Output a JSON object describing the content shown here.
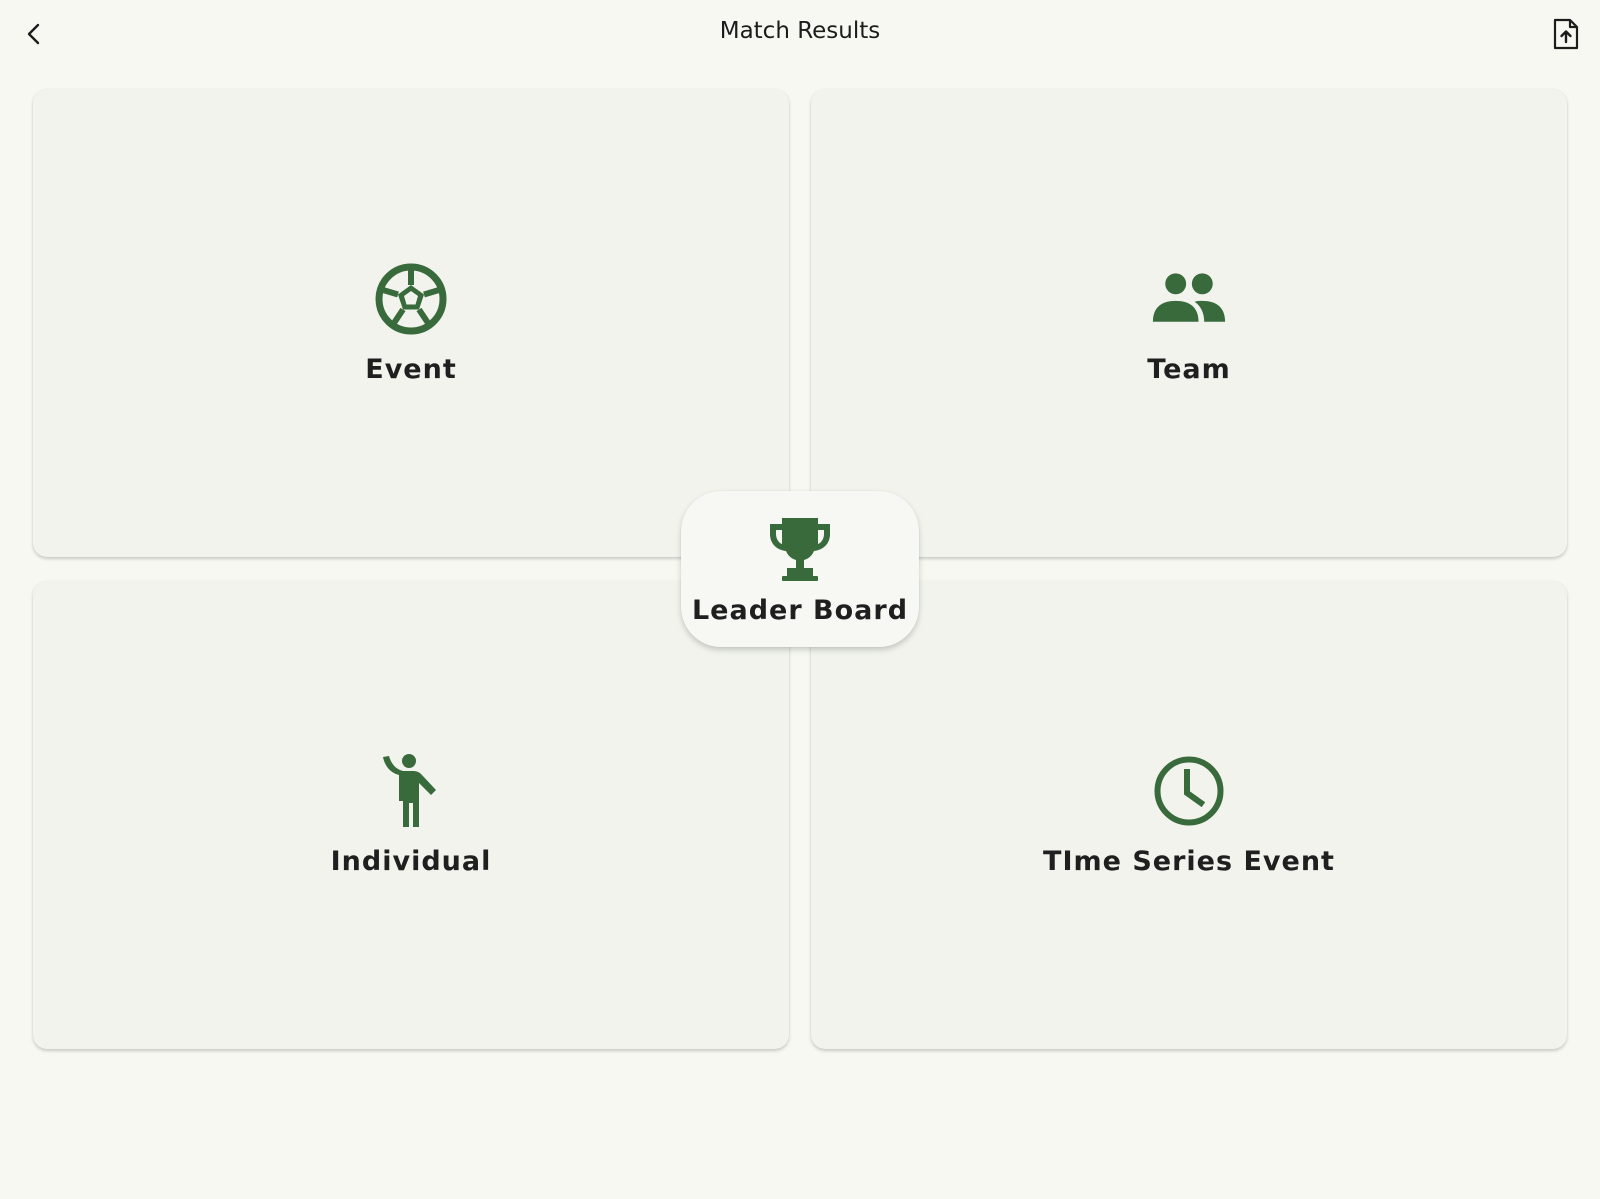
{
  "header": {
    "title": "Match Results",
    "back_icon": "chevron-left-icon",
    "export_icon": "file-upload-icon"
  },
  "cards": {
    "event": {
      "label": "Event",
      "icon": "soccer-ball-icon"
    },
    "team": {
      "label": "Team",
      "icon": "group-icon"
    },
    "individual": {
      "label": "Individual",
      "icon": "person-waving-icon"
    },
    "time_series": {
      "label": "TIme Series Event",
      "icon": "clock-icon"
    }
  },
  "center": {
    "label": "Leader Board",
    "icon": "trophy-icon"
  },
  "colors": {
    "background": "#f6f8f1",
    "card": "#f1f3ec",
    "accent": "#386a3c",
    "text": "#1c1c1c"
  }
}
